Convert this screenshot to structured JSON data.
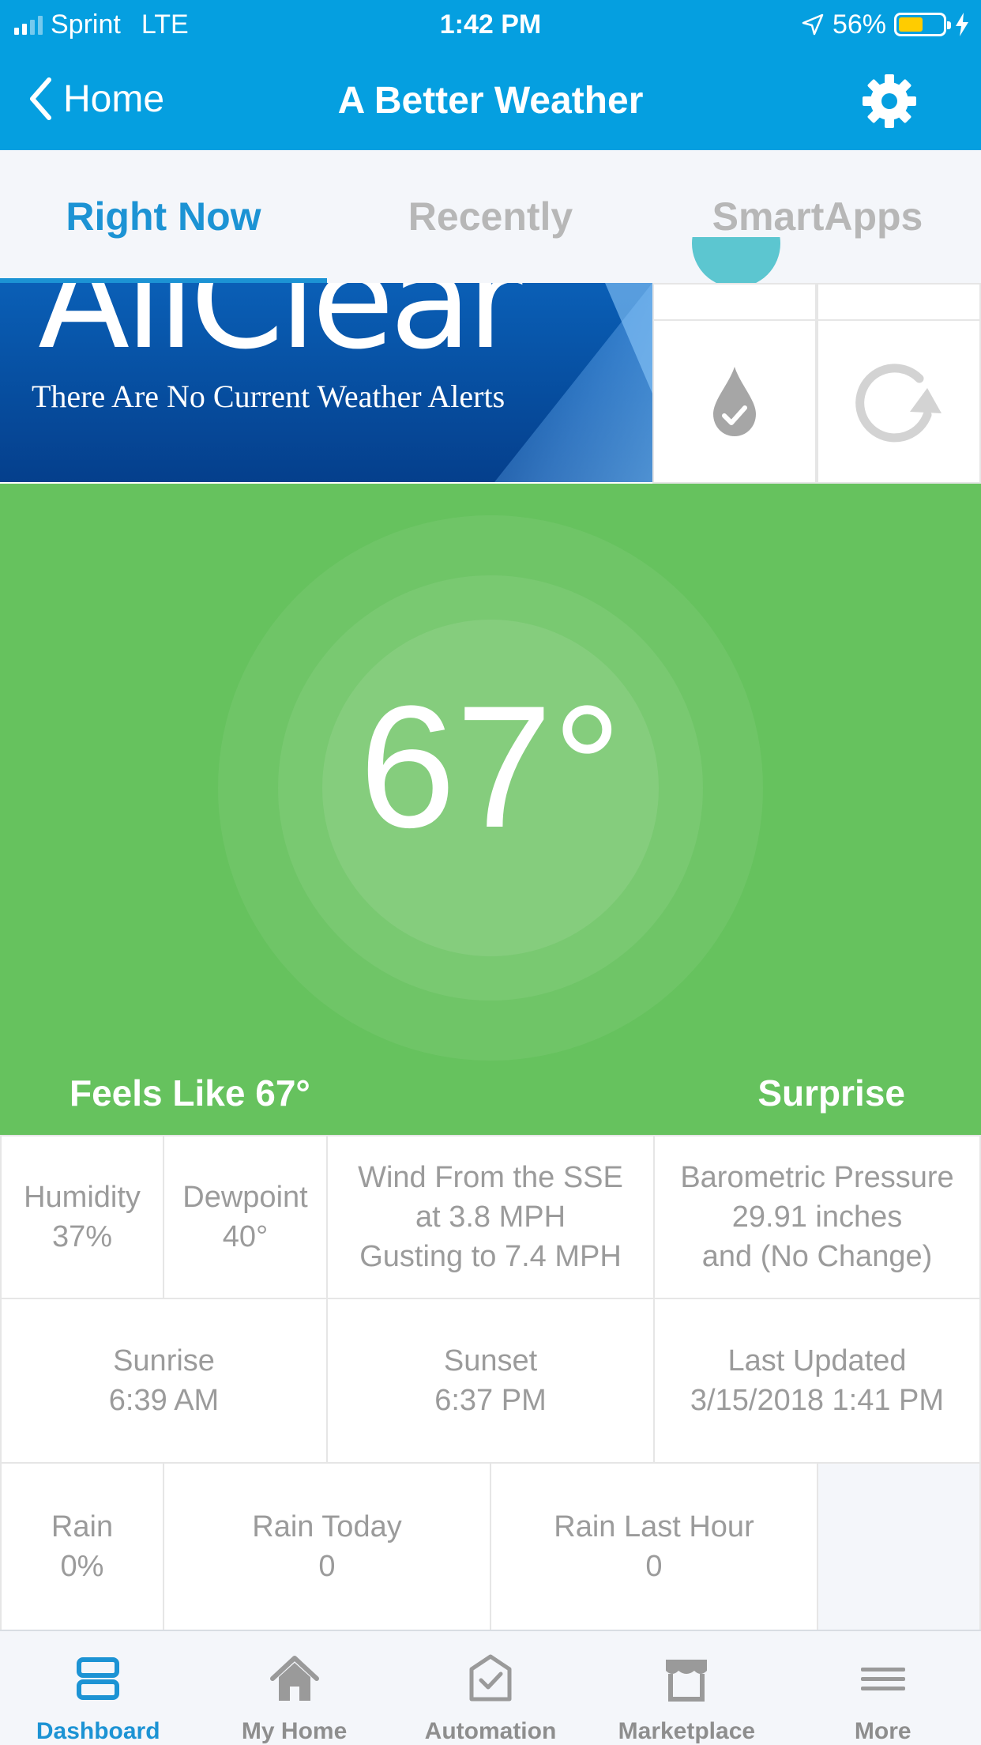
{
  "status_bar": {
    "carrier": "Sprint",
    "network": "LTE",
    "time": "1:42 PM",
    "battery": "56%",
    "battery_level": 0.56,
    "battery_color": "#ffcc00"
  },
  "nav": {
    "back_label": "Home",
    "title": "A Better Weather"
  },
  "tabs": [
    {
      "label": "Right Now",
      "active": true
    },
    {
      "label": "Recently",
      "active": false
    },
    {
      "label": "SmartApps",
      "active": false
    }
  ],
  "banner": {
    "headline": "AllClear",
    "subtitle": "There Are No Current Weather Alerts"
  },
  "temperature": {
    "value": "67°",
    "feels_like": "Feels Like 67°",
    "location": "Surprise",
    "panel_color": "#66c25e"
  },
  "details": {
    "humidity": {
      "label": "Humidity",
      "value": "37%"
    },
    "dewpoint": {
      "label": "Dewpoint",
      "value": "40°"
    },
    "wind": {
      "line1": "Wind From the SSE",
      "line2": "at 3.8 MPH",
      "line3": "Gusting to 7.4 MPH"
    },
    "pressure": {
      "line1": "Barometric Pressure",
      "line2": "29.91 inches",
      "line3": "and (No Change)"
    },
    "sunrise": {
      "label": "Sunrise",
      "value": "6:39 AM"
    },
    "sunset": {
      "label": "Sunset",
      "value": "6:37 PM"
    },
    "last_updated": {
      "label": "Last Updated",
      "value": "3/15/2018 1:41 PM"
    },
    "rain": {
      "label": "Rain",
      "value": "0%"
    },
    "rain_today": {
      "label": "Rain Today",
      "value": "0"
    },
    "rain_last_hour": {
      "label": "Rain Last Hour",
      "value": "0"
    }
  },
  "tabbar": [
    {
      "label": "Dashboard",
      "icon": "dashboard-icon",
      "active": true
    },
    {
      "label": "My Home",
      "icon": "home-icon",
      "active": false
    },
    {
      "label": "Automation",
      "icon": "automation-icon",
      "active": false
    },
    {
      "label": "Marketplace",
      "icon": "marketplace-icon",
      "active": false
    },
    {
      "label": "More",
      "icon": "menu-icon",
      "active": false
    }
  ],
  "colors": {
    "header": "#059fe0",
    "accent": "#1c93d4",
    "alert_banner": "#064c9d"
  }
}
